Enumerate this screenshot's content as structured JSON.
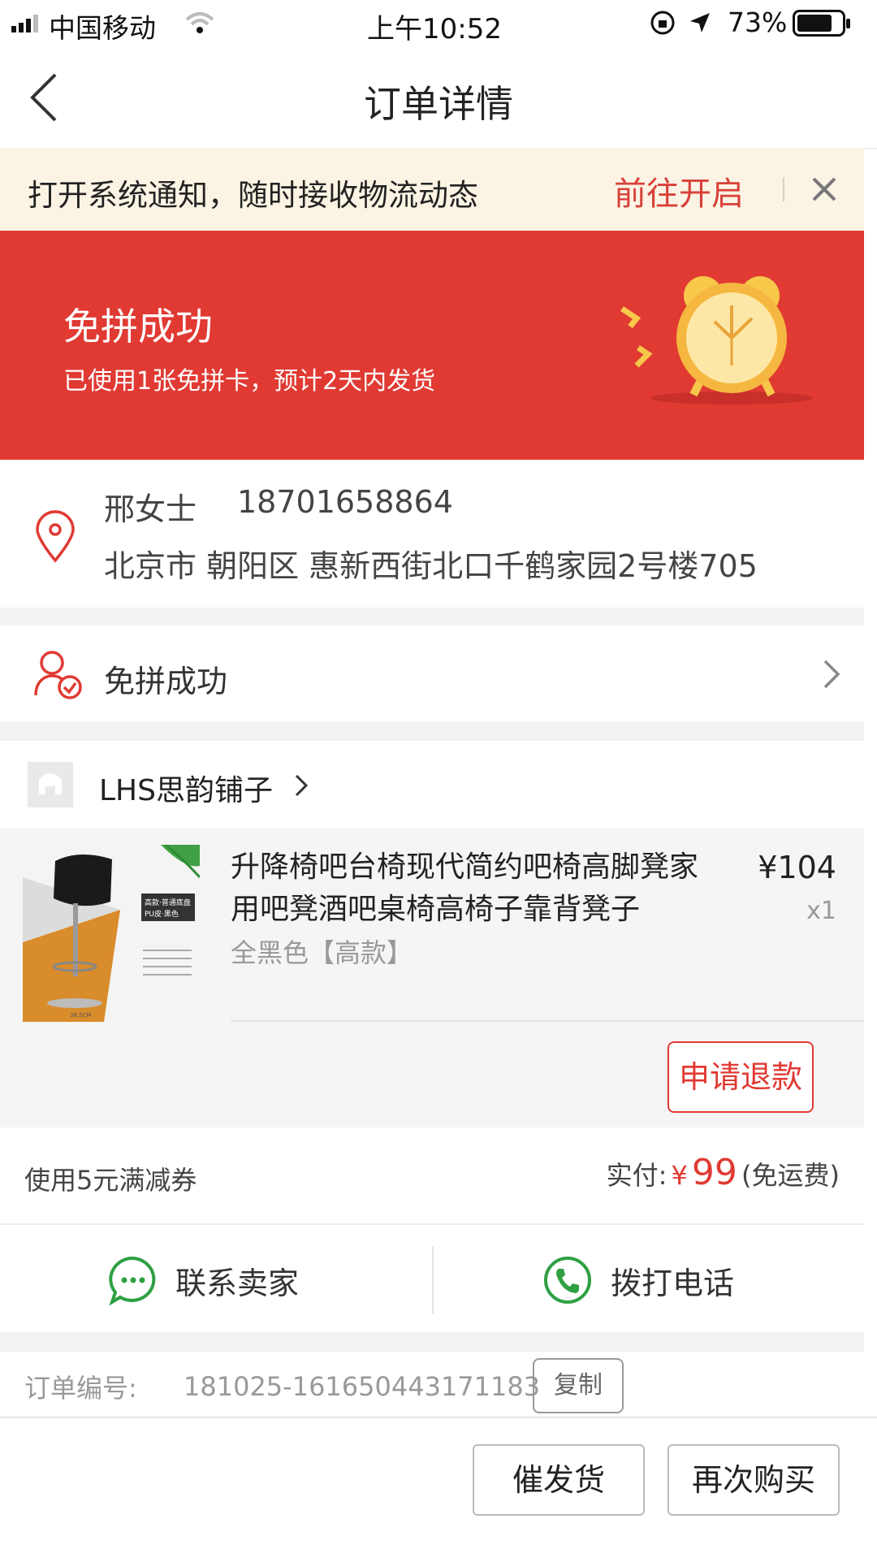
{
  "status_bar": {
    "carrier": "中国移动",
    "time": "上午10:52",
    "battery": "73%"
  },
  "header": {
    "title": "订单详情",
    "back_icon": "chevron-left-icon"
  },
  "notice": {
    "message": "打开系统通知，随时接收物流动态",
    "action": "前往开启",
    "close_icon": "close-icon"
  },
  "banner": {
    "title": "免拼成功",
    "subtitle": "已使用1张免拼卡，预计2天内发货",
    "icon": "alarm-clock-icon"
  },
  "address": {
    "name": "邢女士",
    "phone": "18701658864",
    "line": "北京市 朝阳区 惠新西街北口千鹤家园2号楼705",
    "icon": "location-pin-icon"
  },
  "group_status": {
    "label": "免拼成功",
    "icon": "user-check-icon"
  },
  "shop": {
    "name": "LHS思韵铺子"
  },
  "product": {
    "title": "升降椅吧台椅现代简约吧椅高脚凳家用吧凳酒吧桌椅高椅子靠背凳子",
    "price": "¥104",
    "qty": "x1",
    "spec": "全黑色【高款】",
    "image_labels": {
      "tag_line1": "高款·普通底盘",
      "tag_line2": "PU皮·黑色",
      "dimension": "38.5CM"
    },
    "refund_button": "申请退款"
  },
  "payment": {
    "coupon": "使用5元满减券",
    "paid_label": "实付:",
    "currency": "¥",
    "amount": "99",
    "shipping_note": "(免运费)"
  },
  "contact": {
    "seller": "联系卖家",
    "call": "拨打电话"
  },
  "order_info": {
    "number_label": "订单编号:",
    "number": "181025-161650443171183",
    "copy": "复制"
  },
  "bottom_bar": {
    "urge": "催发货",
    "rebuy": "再次购买"
  },
  "colors": {
    "brand_red": "#e03a33",
    "notice_bg": "#fbf3e3",
    "contact_green": "#2ea043"
  }
}
